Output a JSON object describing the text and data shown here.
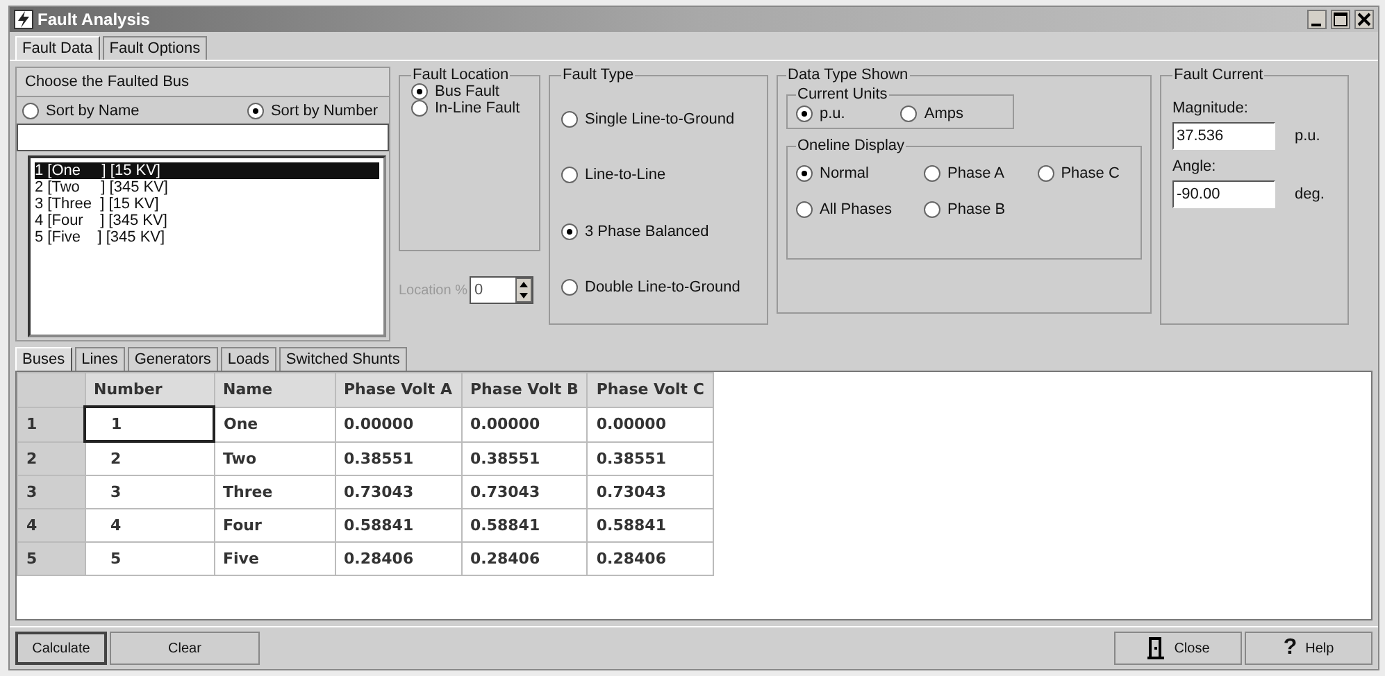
{
  "window": {
    "title": "Fault Analysis"
  },
  "tabs": [
    {
      "label": "Fault Data",
      "selected": true
    },
    {
      "label": "Fault Options",
      "selected": false
    }
  ],
  "bus_chooser": {
    "title": "Choose the Faulted Bus",
    "sort_options": [
      {
        "label": "Sort by Name",
        "selected": false
      },
      {
        "label": "Sort by Number",
        "selected": true
      }
    ],
    "buses": [
      {
        "label": "1 [One     ] [15 KV]",
        "selected": true
      },
      {
        "label": "2 [Two     ] [345 KV]",
        "selected": false
      },
      {
        "label": "3 [Three  ] [15 KV]",
        "selected": false
      },
      {
        "label": "4 [Four    ] [345 KV]",
        "selected": false
      },
      {
        "label": "5 [Five    ] [345 KV]",
        "selected": false
      }
    ]
  },
  "fault_location": {
    "title": "Fault Location",
    "options": [
      {
        "label": "Bus Fault",
        "selected": true
      },
      {
        "label": "In-Line Fault",
        "selected": false
      }
    ],
    "location": {
      "label": "Location %",
      "value": "0",
      "disabled": true
    }
  },
  "fault_type": {
    "title": "Fault Type",
    "options": [
      {
        "label": "Single Line-to-Ground",
        "selected": false
      },
      {
        "label": "Line-to-Line",
        "selected": false
      },
      {
        "label": "3 Phase Balanced",
        "selected": true
      },
      {
        "label": "Double Line-to-Ground",
        "selected": false
      }
    ]
  },
  "data_type": {
    "title": "Data Type Shown",
    "current_units": {
      "title": "Current Units",
      "options": [
        {
          "label": "p.u.",
          "selected": true
        },
        {
          "label": "Amps",
          "selected": false
        }
      ]
    },
    "oneline_display": {
      "title": "Oneline Display",
      "options": [
        {
          "label": "Normal",
          "selected": true
        },
        {
          "label": "Phase A",
          "selected": false
        },
        {
          "label": "Phase C",
          "selected": false
        },
        {
          "label": "All Phases",
          "selected": false
        },
        {
          "label": "Phase B",
          "selected": false
        }
      ]
    }
  },
  "fault_current": {
    "title": "Fault Current",
    "magnitude": {
      "label": "Magnitude:",
      "value": "37.536",
      "unit": "p.u."
    },
    "angle": {
      "label": "Angle:",
      "value": "-90.00",
      "unit": "deg."
    }
  },
  "data_tabs": [
    {
      "label": "Buses",
      "selected": true
    },
    {
      "label": "Lines",
      "selected": false
    },
    {
      "label": "Generators",
      "selected": false
    },
    {
      "label": "Loads",
      "selected": false
    },
    {
      "label": "Switched Shunts",
      "selected": false
    }
  ],
  "table": {
    "columns": [
      "Number",
      "Name",
      "Phase Volt A",
      "Phase Volt B",
      "Phase Volt C"
    ],
    "rows": [
      {
        "header": "1",
        "focused": true,
        "cells": [
          "1",
          "One",
          "0.00000",
          "0.00000",
          "0.00000"
        ]
      },
      {
        "header": "2",
        "focused": false,
        "cells": [
          "2",
          "Two",
          "0.38551",
          "0.38551",
          "0.38551"
        ]
      },
      {
        "header": "3",
        "focused": false,
        "cells": [
          "3",
          "Three",
          "0.73043",
          "0.73043",
          "0.73043"
        ]
      },
      {
        "header": "4",
        "focused": false,
        "cells": [
          "4",
          "Four",
          "0.58841",
          "0.58841",
          "0.58841"
        ]
      },
      {
        "header": "5",
        "focused": false,
        "cells": [
          "5",
          "Five",
          "0.28406",
          "0.28406",
          "0.28406"
        ]
      }
    ]
  },
  "left_buttons": [
    {
      "label": "Calculate",
      "kind": "default"
    },
    {
      "label": "Clear",
      "kind": "plain"
    }
  ],
  "right_buttons": [
    {
      "label": "Close",
      "kind": "door"
    },
    {
      "label": "Help",
      "kind": "help",
      "icon_text": "?"
    }
  ]
}
